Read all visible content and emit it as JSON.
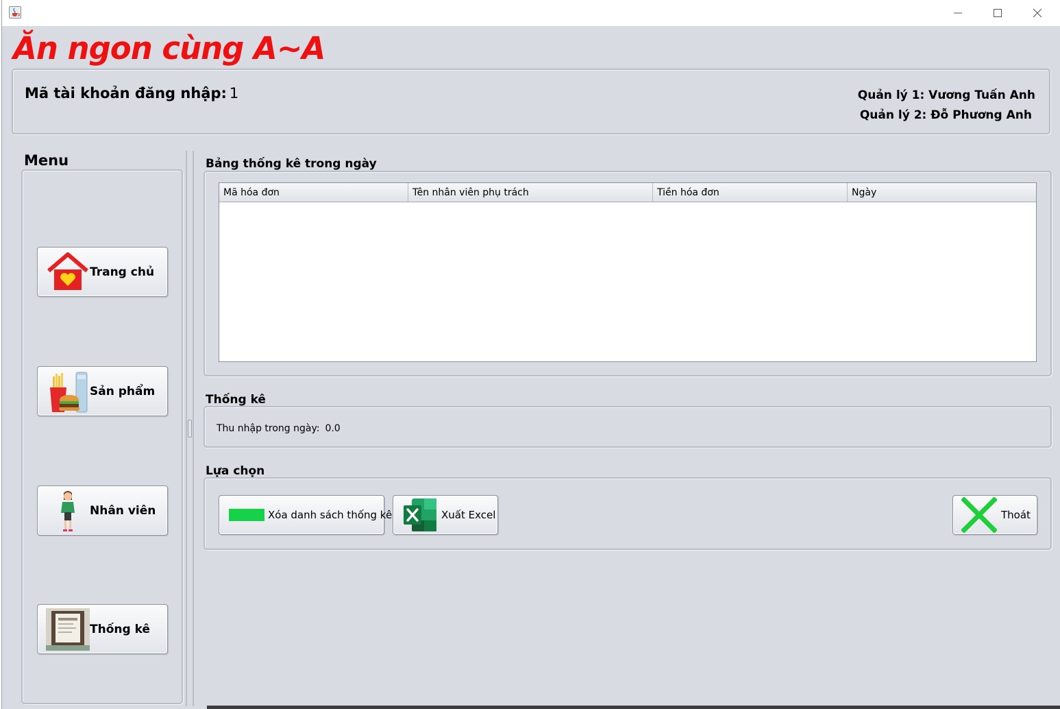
{
  "window": {
    "icon": "java-cup-icon",
    "controls": [
      "minimize-icon",
      "maximize-icon",
      "close-icon"
    ]
  },
  "brand": {
    "title": "Ăn ngon cùng A~A",
    "color": "#ee1111"
  },
  "header": {
    "account_label": "Mã tài khoản đăng nhập:",
    "account_value": "1",
    "manager1": "Quản lý 1: Vương Tuấn Anh",
    "manager2": "Quản lý 2: Đỗ Phương Anh"
  },
  "menu": {
    "title": "Menu",
    "items": [
      {
        "label": "Trang chủ",
        "icon": "home-heart-icon"
      },
      {
        "label": "Sản phẩm",
        "icon": "fastfood-icon"
      },
      {
        "label": "Nhân viên",
        "icon": "employee-icon"
      },
      {
        "label": "Thống kê",
        "icon": "statistics-photo-icon"
      }
    ]
  },
  "daily": {
    "title": "Bảng thống kê trong ngày",
    "columns": [
      "Mã hóa đơn",
      "Tên nhân viên phụ trách",
      "Tiền hóa đơn",
      "Ngày"
    ],
    "rows": []
  },
  "stats": {
    "title": "Thống kê",
    "income_label": "Thu nhập trong ngày:",
    "income_value": "0.0"
  },
  "choices": {
    "title": "Lựa chọn",
    "clear_label": "Xóa danh sách thống kê",
    "excel_label": "Xuất Excel",
    "exit_label": "Thoát"
  }
}
